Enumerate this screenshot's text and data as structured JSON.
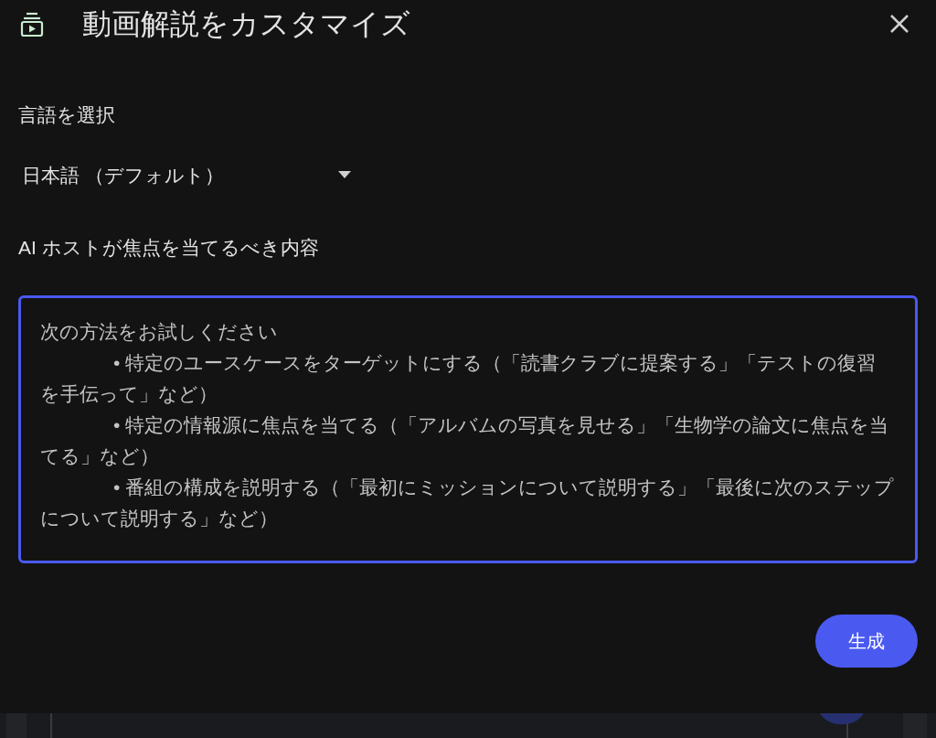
{
  "dialog": {
    "title": "動画解説をカスタマイズ"
  },
  "language": {
    "label": "言語を選択",
    "value": "日本語 （デフォルト）"
  },
  "focus": {
    "label": "AI ホストが焦点を当てるべき内容",
    "placeholder_intro": "次の方法をお試しください",
    "placeholder_bullets": [
      "• 特定のユースケースをターゲットにする（「読書クラブに提案する」「テストの復習を手伝って」など）",
      "• 特定の情報源に焦点を当てる（「アルバムの写真を見せる」「生物学の論文に焦点を当てる」など）",
      "• 番組の構成を説明する（「最初にミッションについて説明する」「最後に次のステップについて説明する」など）"
    ]
  },
  "buttons": {
    "generate": "生成"
  }
}
